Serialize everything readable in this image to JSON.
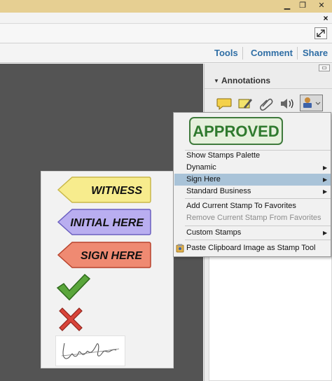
{
  "window": {
    "minimize": "▁",
    "maximize": "❐",
    "close": "✕"
  },
  "menubar": {
    "close": "×"
  },
  "toolbar": {
    "fullscreen_icon": "expand-icon"
  },
  "tabs": [
    {
      "label": "Tools"
    },
    {
      "label": "Comment"
    },
    {
      "label": "Share"
    }
  ],
  "annotations": {
    "title": "Annotations",
    "tools": [
      "sticky-note-icon",
      "highlight-text-icon",
      "attach-file-icon",
      "record-audio-icon",
      "stamp-icon"
    ]
  },
  "stamp_menu": {
    "preview_stamp": "APPROVED",
    "items": [
      {
        "label": "Show Stamps Palette",
        "submenu": false,
        "disabled": false
      },
      {
        "label": "Dynamic",
        "submenu": true,
        "disabled": false
      },
      {
        "label": "Sign Here",
        "submenu": true,
        "disabled": false,
        "highlighted": true
      },
      {
        "label": "Standard Business",
        "submenu": true,
        "disabled": false
      },
      {
        "label": "Add Current Stamp To Favorites",
        "submenu": false,
        "disabled": false
      },
      {
        "label": "Remove Current Stamp From Favorites",
        "submenu": false,
        "disabled": true
      },
      {
        "label": "Custom Stamps",
        "submenu": true,
        "disabled": false
      },
      {
        "label": "Paste Clipboard Image as Stamp Tool",
        "submenu": false,
        "disabled": false
      }
    ]
  },
  "sign_here_stamps": {
    "witness": "WITNESS",
    "initial_here": "INITIAL HERE",
    "sign_here": "SIGN HERE",
    "colors": {
      "witness": "#f7ec8d",
      "initial_here": "#b9aef0",
      "sign_here": "#ef8a72"
    }
  },
  "colors": {
    "title_bar": "#e6cf92",
    "tab_text": "#2f6ea5",
    "doc_background": "#545454",
    "menu_highlight": "#a9c3d8",
    "approved_green": "#2f7a2e"
  }
}
